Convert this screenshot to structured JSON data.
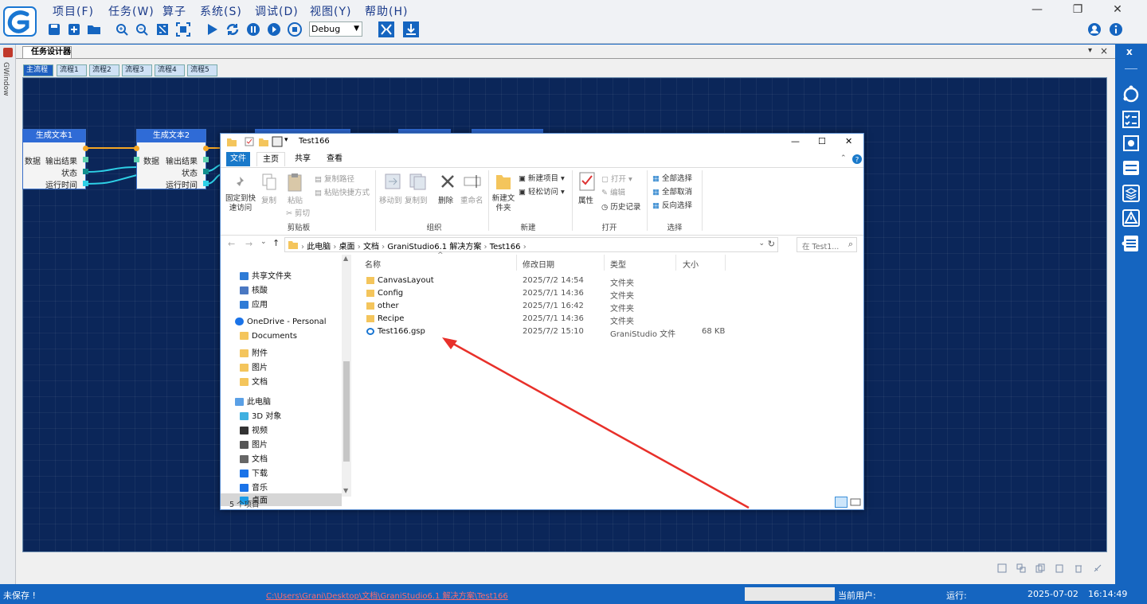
{
  "app": {
    "menu": [
      "项目(F)",
      "任务(W)",
      "算子",
      "系统(S)",
      "调试(D)",
      "视图(Y)",
      "帮助(H)"
    ],
    "debug_mode": "Debug",
    "left_strip_label": "GWindow"
  },
  "document": {
    "tab_title": "任务设计器",
    "close_glyph": "×",
    "pin_glyph": "▾",
    "sub_tabs": [
      "主流程",
      "流程1",
      "流程2",
      "流程3",
      "流程4",
      "流程5"
    ]
  },
  "nodes": [
    {
      "title": "生成文本1",
      "in_label": "数据",
      "out_labels": [
        "输出结果",
        "状态",
        "运行时间"
      ]
    },
    {
      "title": "生成文本2",
      "in_label": "数据",
      "out_labels": [
        "输出结果",
        "状态",
        "运行时间"
      ]
    }
  ],
  "explorer": {
    "title": "Test166",
    "window_buttons": [
      "—",
      "☐",
      "✕"
    ],
    "tabs": [
      "文件",
      "主页",
      "共享",
      "查看"
    ],
    "ribbon": {
      "clipboard": {
        "pin": "固定到快速访问",
        "copy": "复制",
        "paste": "粘贴",
        "copy_path": "复制路径",
        "paste_shortcut": "粘贴快捷方式",
        "cut": "剪切",
        "group": "剪贴板"
      },
      "organize": {
        "move_to": "移动到",
        "copy_to": "复制到",
        "delete": "删除",
        "rename": "重命名",
        "group": "组织"
      },
      "new": {
        "new_folder": "新建文件夹",
        "new_item": "新建项目",
        "easy_access": "轻松访问",
        "group": "新建"
      },
      "open": {
        "properties": "属性",
        "open": "打开",
        "edit": "编辑",
        "history": "历史记录",
        "group": "打开"
      },
      "select": {
        "select_all": "全部选择",
        "select_none": "全部取消",
        "invert": "反向选择",
        "group": "选择"
      }
    },
    "address": [
      "此电脑",
      "桌面",
      "文档",
      "GraniStudio6.1 解决方案",
      "Test166"
    ],
    "search_placeholder": "在 Test1...",
    "nav": [
      {
        "label": "共享文件夹",
        "icon": "network-icon"
      },
      {
        "label": "核酸",
        "icon": "people-icon"
      },
      {
        "label": "应用",
        "icon": "apps-icon"
      },
      {
        "label": "OneDrive - Personal",
        "icon": "cloud-icon"
      },
      {
        "label": "Documents",
        "icon": "folder-icon"
      },
      {
        "label": "附件",
        "icon": "folder-icon"
      },
      {
        "label": "图片",
        "icon": "folder-icon"
      },
      {
        "label": "文档",
        "icon": "folder-icon"
      },
      {
        "label": "此电脑",
        "icon": "computer-icon"
      },
      {
        "label": "3D 对象",
        "icon": "cube-icon"
      },
      {
        "label": "视频",
        "icon": "video-icon"
      },
      {
        "label": "图片",
        "icon": "picture-icon"
      },
      {
        "label": "文档",
        "icon": "document-icon"
      },
      {
        "label": "下载",
        "icon": "download-icon"
      },
      {
        "label": "音乐",
        "icon": "music-icon"
      },
      {
        "label": "桌面",
        "icon": "desktop-icon"
      }
    ],
    "columns": [
      "名称",
      "修改日期",
      "类型",
      "大小"
    ],
    "files": [
      {
        "name": "CanvasLayout",
        "date": "2025/7/2 14:54",
        "type": "文件夹",
        "size": ""
      },
      {
        "name": "Config",
        "date": "2025/7/1 14:36",
        "type": "文件夹",
        "size": ""
      },
      {
        "name": "other",
        "date": "2025/7/1 16:42",
        "type": "文件夹",
        "size": ""
      },
      {
        "name": "Recipe",
        "date": "2025/7/1 14:36",
        "type": "文件夹",
        "size": ""
      },
      {
        "name": "Test166.gsp",
        "date": "2025/7/2 15:10",
        "type": "GraniStudio 文件",
        "size": "68 KB"
      }
    ],
    "status": "5 个项目"
  },
  "statusbar": {
    "save_state": "未保存 !",
    "path": "C:\\Users\\Grani\\Desktop\\文档\\GraniStudio6.1 解决方案\\Test166",
    "user_label": "当前用户:",
    "run_label": "运行:",
    "date": "2025-07-02",
    "time": "16:14:49"
  },
  "colors": {
    "canvas": "#0b2659",
    "accent": "#1565c0",
    "arrow": "#e8302a"
  }
}
